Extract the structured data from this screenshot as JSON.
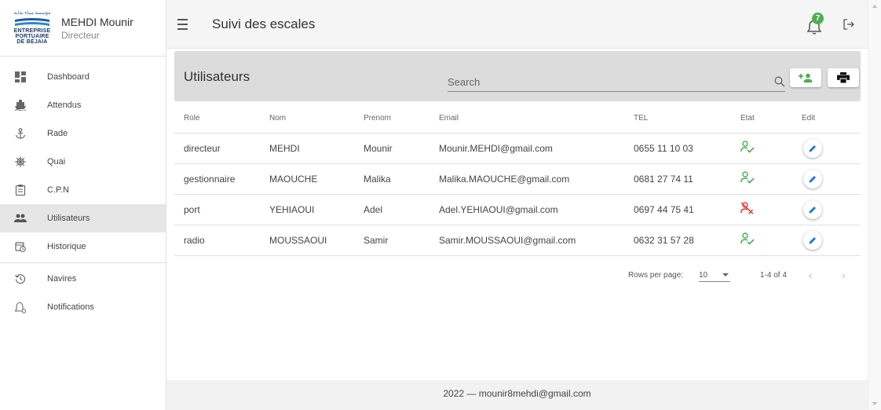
{
  "brand": {
    "logo_arabic": "مؤسسة ميناء بجاية",
    "logo_lines": [
      "ENTREPRISE",
      "PORTUAIRE",
      "DE BEJAIA"
    ],
    "user_name": "MEHDI Mounir",
    "user_role": "Directeur"
  },
  "sidebar": {
    "items": [
      {
        "label": "Dashboard",
        "icon": "dashboard-icon"
      },
      {
        "label": "Attendus",
        "icon": "ship-icon"
      },
      {
        "label": "Rade",
        "icon": "anchor-icon"
      },
      {
        "label": "Quai",
        "icon": "helm-icon"
      },
      {
        "label": "C.P.N",
        "icon": "clipboard-icon"
      },
      {
        "label": "Utilisateurs",
        "icon": "users-icon",
        "active": true
      },
      {
        "label": "Historique",
        "icon": "calendar-clock-icon"
      },
      {
        "label": "Navires",
        "icon": "history-icon"
      },
      {
        "label": "Notifications",
        "icon": "bell-settings-icon"
      }
    ]
  },
  "topbar": {
    "title": "Suivi des escales",
    "notification_count": "7"
  },
  "main": {
    "title": "Utilisateurs",
    "search_placeholder": "Search",
    "columns": [
      "Role",
      "Nom",
      "Prenom",
      "Email",
      "TEL",
      "Etat",
      "Edit"
    ],
    "rows": [
      {
        "role": "directeur",
        "nom": "MEHDI",
        "prenom": "Mounir",
        "email": "Mounir.MEHDI@gmail.com",
        "tel": "0655 11 10 03",
        "etat": "active"
      },
      {
        "role": "gestionnaire",
        "nom": "MAOUCHE",
        "prenom": "Malika",
        "email": "Malika.MAOUCHE@gmail.com",
        "tel": "0681 27 74 11",
        "etat": "active"
      },
      {
        "role": "port",
        "nom": "YEHIAOUI",
        "prenom": "Adel",
        "email": "Adel.YEHIAOUI@gmail.com",
        "tel": "0697 44 75 41",
        "etat": "inactive"
      },
      {
        "role": "radio",
        "nom": "MOUSSAOUI",
        "prenom": "Samir",
        "email": "Samir.MOUSSAOUI@gmail.com",
        "tel": "0632 31 57 28",
        "etat": "active"
      }
    ],
    "pagination": {
      "rows_per_page_label": "Rows per page:",
      "rows_per_page": "10",
      "range": "1-4 of 4"
    }
  },
  "footer": {
    "text": "2022 — mounir8mehdi@gmail.com"
  },
  "colors": {
    "accent_green": "#4caf50",
    "inactive_red": "#e53935",
    "edit_blue": "#1976d2",
    "header_gray": "#dcdcdc"
  }
}
